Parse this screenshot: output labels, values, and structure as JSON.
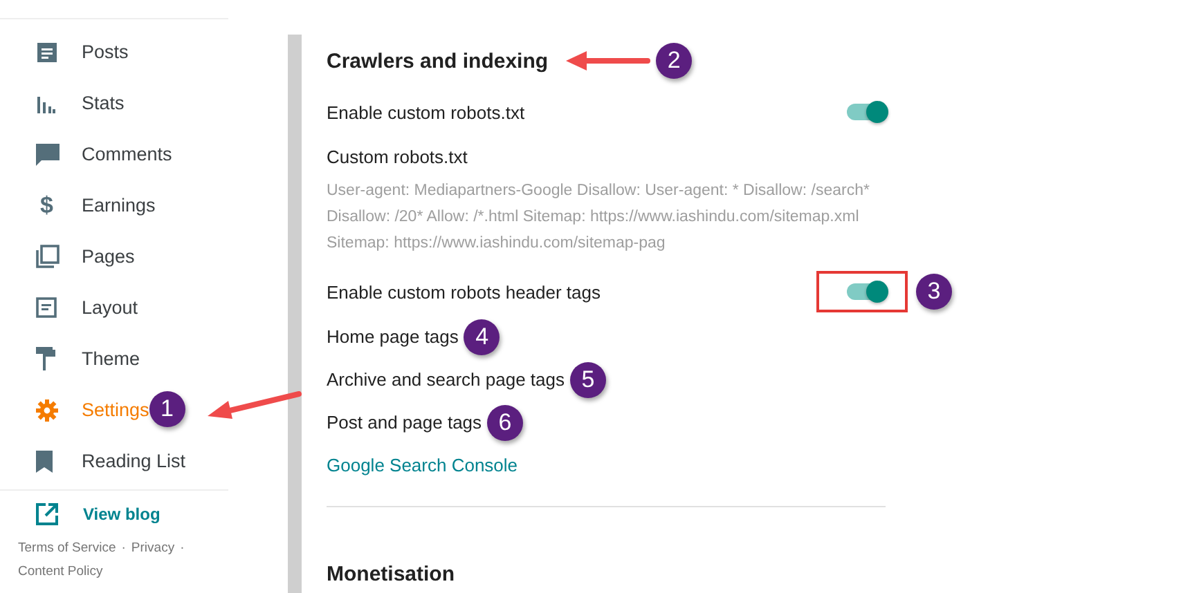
{
  "sidebar": {
    "items": [
      {
        "label": "Posts",
        "selected": false
      },
      {
        "label": "Stats",
        "selected": false
      },
      {
        "label": "Comments",
        "selected": false
      },
      {
        "label": "Earnings",
        "glyph": "$",
        "selected": false
      },
      {
        "label": "Pages",
        "selected": false
      },
      {
        "label": "Layout",
        "selected": false
      },
      {
        "label": "Theme",
        "selected": false
      },
      {
        "label": "Settings",
        "selected": true,
        "badge": "1"
      },
      {
        "label": "Reading List",
        "selected": false
      }
    ],
    "view_blog": "View blog",
    "footer_links": [
      "Terms of Service",
      "Privacy",
      "Content Policy"
    ],
    "separator": "·"
  },
  "section": {
    "title": "Crawlers and indexing",
    "badge": "2",
    "rows": [
      {
        "kind": "toggle",
        "label": "Enable custom robots.txt",
        "on": true,
        "highlighted": false
      },
      {
        "kind": "text",
        "label": "Custom robots.txt",
        "description": "User-agent: Mediapartners-Google Disallow: User-agent: * Disallow: /search* Disallow: /20* Allow: /*.html Sitemap: https://www.iashindu.com/sitemap.xml Sitemap: https://www.iashindu.com/sitemap-pag"
      },
      {
        "kind": "toggle",
        "label": "Enable custom robots header tags",
        "on": true,
        "highlighted": true,
        "badge": "3"
      },
      {
        "kind": "text",
        "label": "Home page tags",
        "badge": "4"
      },
      {
        "kind": "text",
        "label": "Archive and search page tags",
        "badge": "5"
      },
      {
        "kind": "text",
        "label": "Post and page tags",
        "badge": "6"
      },
      {
        "kind": "link",
        "label": "Google Search Console"
      }
    ]
  },
  "next_section": {
    "title": "Monetisation"
  }
}
